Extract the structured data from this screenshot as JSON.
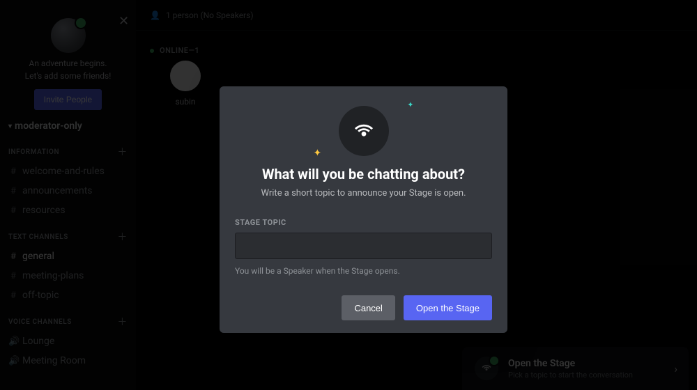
{
  "sidebar": {
    "adventure": {
      "line1": "An adventure begins.",
      "line2": "Let's add some friends!",
      "invite_label": "Invite People"
    },
    "categories": [
      {
        "name": "moderator-only"
      },
      {
        "name": "INFORMATION",
        "channels": [
          "welcome-and-rules",
          "announcements",
          "resources"
        ]
      },
      {
        "name": "TEXT CHANNELS",
        "channels": [
          "general",
          "meeting-plans",
          "off-topic"
        ]
      },
      {
        "name": "VOICE CHANNELS",
        "channels": [
          "Lounge",
          "Meeting Room"
        ]
      }
    ]
  },
  "main": {
    "header": "1 person (No Speakers)",
    "online_label": "ONLINE—1",
    "participants": [
      "subin"
    ],
    "open_stage": {
      "title": "Open the Stage",
      "subtitle": "Pick a topic to start the conversation"
    }
  },
  "modal": {
    "title": "What will you be chatting about?",
    "subtitle": "Write a short topic to announce your Stage is open.",
    "field_label": "STAGE TOPIC",
    "field_value": "",
    "hint": "You will be a Speaker when the Stage opens.",
    "cancel_label": "Cancel",
    "primary_label": "Open the Stage"
  }
}
